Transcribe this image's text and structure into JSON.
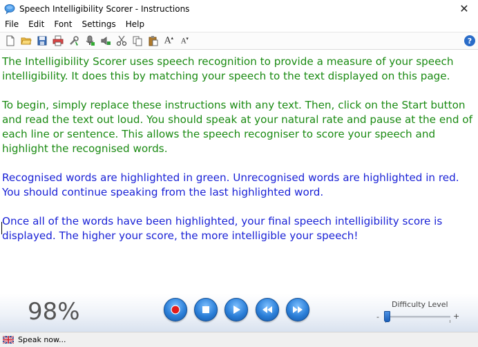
{
  "window": {
    "title": "Speech Intelligibility Scorer - Instructions",
    "close_glyph": "✕"
  },
  "menu": {
    "items": [
      "File",
      "Edit",
      "Font",
      "Settings",
      "Help"
    ]
  },
  "toolbar": {
    "icons": [
      "new-document-icon",
      "open-folder-icon",
      "save-icon",
      "print-icon",
      "tools-icon",
      "microphone-settings-icon",
      "speaker-icon",
      "cut-icon",
      "copy-icon",
      "paste-icon",
      "increase-font-icon",
      "decrease-font-icon"
    ],
    "font_increase_label": "A",
    "font_decrease_label": "A",
    "help_label": "?"
  },
  "content": {
    "paragraphs": [
      {
        "color": "green",
        "text": "The Intelligibility Scorer uses speech recognition to provide a measure of your speech intelligibility. It does this by matching your speech to the text displayed on this page."
      },
      {
        "color": "green",
        "text": "To begin, simply replace these instructions with any text. Then, click on the Start button and read the text out loud. You should speak at your natural rate and pause at the end of each line or sentence. This allows the speech recogniser to score your speech and highlight the recognised words."
      },
      {
        "color": "blue",
        "text": "Recognised words are highlighted in green. Unrecognised words are highlighted in red. You should continue speaking from the last highlighted word."
      },
      {
        "color": "blue",
        "text": "Once all of the words have been highlighted, your final speech intelligibility score is displayed. The higher your score, the more intelligible your speech!"
      }
    ],
    "colors": {
      "green": "#1a8a12",
      "blue": "#1a22d6"
    }
  },
  "controls": {
    "score": "98%",
    "buttons": [
      "record",
      "stop",
      "play",
      "rewind",
      "fast-forward"
    ],
    "difficulty": {
      "label": "Difficulty Level",
      "minus": "-",
      "plus": "+",
      "value": 0
    }
  },
  "status": {
    "text": "Speak now..."
  }
}
